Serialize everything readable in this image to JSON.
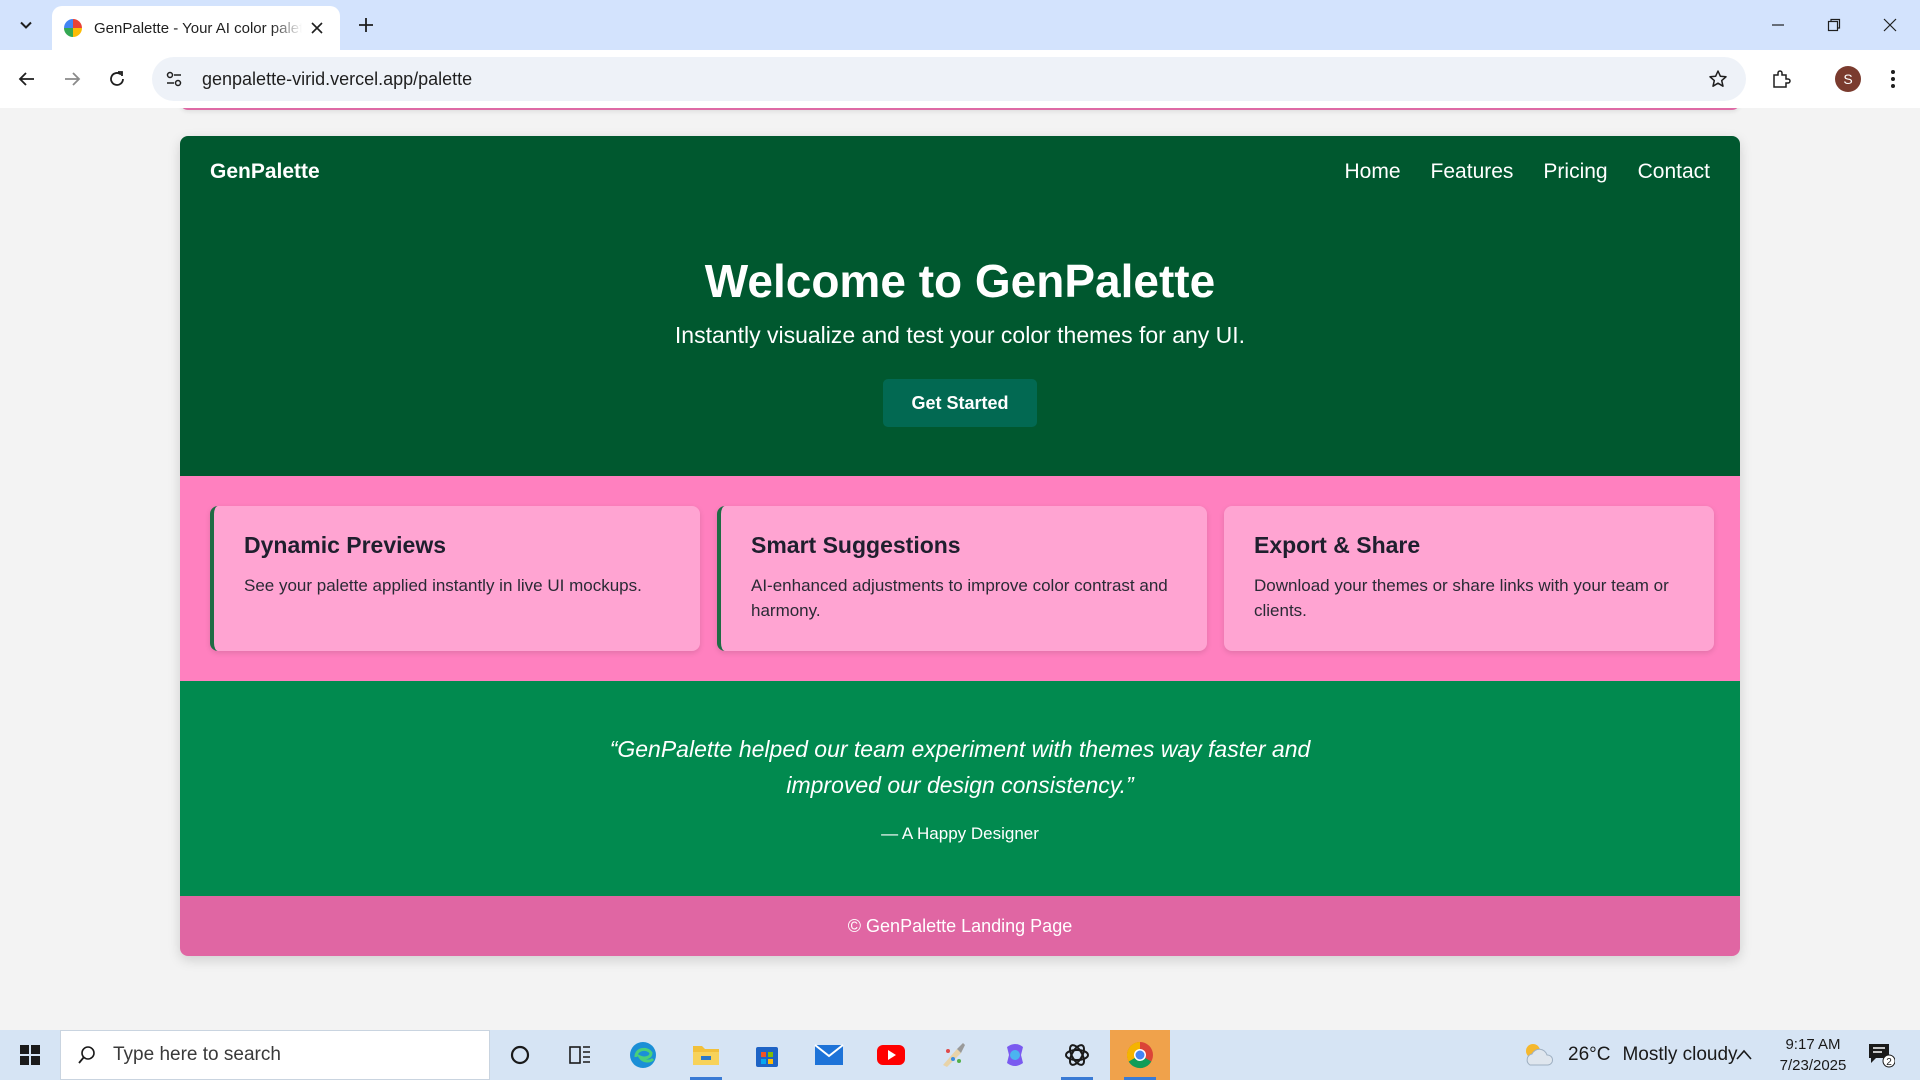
{
  "browser": {
    "tab_title": "GenPalette - Your AI color palette",
    "url": "genpalette-virid.vercel.app/palette",
    "profile_initial": "S"
  },
  "site": {
    "brand": "GenPalette",
    "nav": [
      "Home",
      "Features",
      "Pricing",
      "Contact"
    ],
    "hero_title": "Welcome to GenPalette",
    "hero_subtitle": "Instantly visualize and test your color themes for any UI.",
    "cta_label": "Get Started",
    "features": [
      {
        "title": "Dynamic Previews",
        "desc": "See your palette applied instantly in live UI mockups."
      },
      {
        "title": "Smart Suggestions",
        "desc": "AI-enhanced adjustments to improve color contrast and harmony."
      },
      {
        "title": "Export & Share",
        "desc": "Download your themes or share links with your team or clients."
      }
    ],
    "quote": "“GenPalette helped our team experiment with themes way faster and improved our design consistency.”",
    "quote_author": "— A Happy Designer",
    "footer": "© GenPalette Landing Page"
  },
  "colors": {
    "hero_bg": "#00582f",
    "cta_bg": "#026952",
    "features_bg": "#ff80bf",
    "feature_card_bg": "#ffa4d2",
    "feature_accent": "#1f6b45",
    "testimonial_bg": "#018a4f",
    "footer_bg": "#e066a3"
  },
  "taskbar": {
    "search_placeholder": "Type here to search",
    "temperature": "26°C",
    "weather": "Mostly cloudy",
    "time": "9:17 AM",
    "date": "7/23/2025",
    "notification_count": "2"
  }
}
